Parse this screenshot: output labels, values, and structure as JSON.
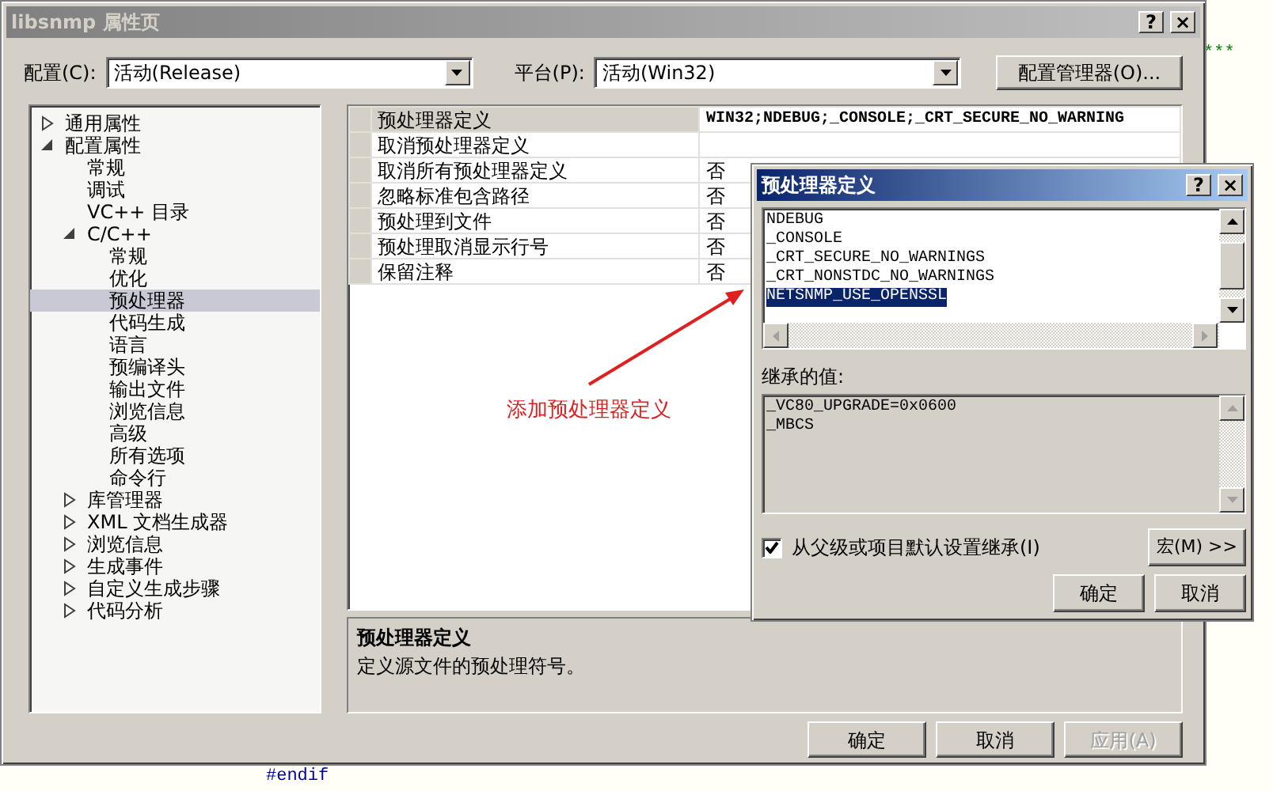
{
  "background_code": [
    {
      "text": "***"
    },
    {
      "text": "#endif"
    }
  ],
  "window": {
    "title": "libsnmp 属性页",
    "title_buttons": [
      "?",
      "×"
    ]
  },
  "config": {
    "label": "配置(C):",
    "value": "活动(Release)"
  },
  "platform": {
    "label": "平台(P):",
    "value": "活动(Win32)"
  },
  "config_manager_button": "配置管理器(O)...",
  "tree": [
    {
      "label": "通用属性",
      "expanded": false,
      "selected": false
    },
    {
      "label": "配置属性",
      "expanded": true,
      "selected": false,
      "children": [
        {
          "label": "常规",
          "selected": false
        },
        {
          "label": "调试",
          "selected": false
        },
        {
          "label": "VC++ 目录",
          "selected": false
        },
        {
          "label": "C/C++",
          "expanded": true,
          "selected": false,
          "children": [
            {
              "label": "常规",
              "selected": false
            },
            {
              "label": "优化",
              "selected": false
            },
            {
              "label": "预处理器",
              "selected": true
            },
            {
              "label": "代码生成",
              "selected": false
            },
            {
              "label": "语言",
              "selected": false
            },
            {
              "label": "预编译头",
              "selected": false
            },
            {
              "label": "输出文件",
              "selected": false
            },
            {
              "label": "浏览信息",
              "selected": false
            },
            {
              "label": "高级",
              "selected": false
            },
            {
              "label": "所有选项",
              "selected": false
            },
            {
              "label": "命令行",
              "selected": false
            }
          ]
        },
        {
          "label": "库管理器",
          "expanded": false,
          "selected": false
        },
        {
          "label": "XML 文档生成器",
          "expanded": false,
          "selected": false
        },
        {
          "label": "浏览信息",
          "expanded": false,
          "selected": false
        },
        {
          "label": "生成事件",
          "expanded": false,
          "selected": false
        },
        {
          "label": "自定义生成步骤",
          "expanded": false,
          "selected": false
        },
        {
          "label": "代码分析",
          "expanded": false,
          "selected": false
        }
      ]
    }
  ],
  "properties": [
    {
      "name": "预处理器定义",
      "value": "WIN32;NDEBUG;_CONSOLE;_CRT_SECURE_NO_WARNING",
      "selected": true,
      "modified": true
    },
    {
      "name": "取消预处理器定义",
      "selected": false,
      "modified": false
    },
    {
      "name": "取消所有预处理器定义",
      "value": "否",
      "selected": false,
      "modified": false
    },
    {
      "name": "忽略标准包含路径",
      "value": "否",
      "selected": false,
      "modified": false
    },
    {
      "name": "预处理到文件",
      "value": "否",
      "selected": false,
      "modified": false
    },
    {
      "name": "预处理取消显示行号",
      "value": "否",
      "selected": false,
      "modified": false
    },
    {
      "name": "保留注释",
      "value": "否",
      "selected": false,
      "modified": false
    }
  ],
  "description": {
    "title": "预处理器定义",
    "text": "定义源文件的预处理符号。"
  },
  "buttons": [
    {
      "label": "确定",
      "disabled": false
    },
    {
      "label": "取消",
      "disabled": false
    },
    {
      "label": "应用(A)",
      "disabled": true
    }
  ],
  "annotation": {
    "text": "添加预处理器定义"
  },
  "popup": {
    "title": "预处理器定义",
    "title_buttons": [
      "?",
      "×"
    ],
    "definitions": [
      {
        "text": "NDEBUG",
        "selected": false
      },
      {
        "text": "_CONSOLE",
        "selected": false
      },
      {
        "text": "_CRT_SECURE_NO_WARNINGS",
        "selected": false
      },
      {
        "text": "_CRT_NONSTDC_NO_WARNINGS",
        "selected": false
      },
      {
        "text": "NETSNMP_USE_OPENSSL",
        "selected": true
      }
    ],
    "inherited_label": "继承的值:",
    "inherited": [
      "_VC80_UPGRADE=0x0600",
      "_MBCS"
    ],
    "inherit_checkbox": {
      "label": "从父级或项目默认设置继承(I)",
      "checked": true
    },
    "macro_button": "宏(M) >>",
    "buttons": [
      "确定",
      "取消"
    ]
  }
}
